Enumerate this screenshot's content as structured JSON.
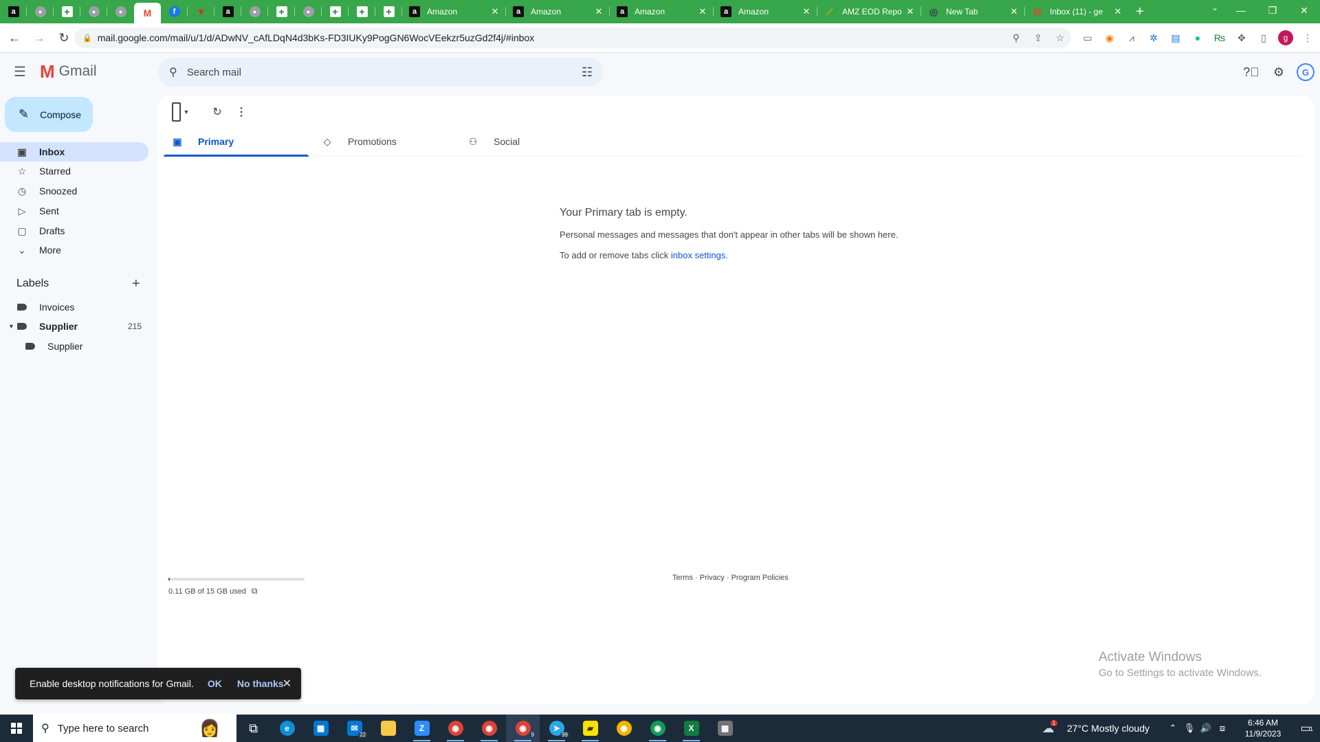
{
  "browser": {
    "pinned_tabs": [
      {
        "icon": "amazon-icon",
        "glyph": "a"
      },
      {
        "icon": "globe-icon",
        "glyph": "●"
      },
      {
        "icon": "sheets-icon",
        "glyph": "+"
      },
      {
        "icon": "globe-icon",
        "glyph": "●"
      },
      {
        "icon": "globe-icon",
        "glyph": "●"
      },
      {
        "icon": "gmail-icon",
        "glyph": "M"
      },
      {
        "icon": "facebook-icon",
        "glyph": "f"
      },
      {
        "icon": "red-shield-icon",
        "glyph": "▼"
      },
      {
        "icon": "amazon-icon",
        "glyph": "a"
      },
      {
        "icon": "globe-icon",
        "glyph": "●"
      },
      {
        "icon": "sheets-icon",
        "glyph": "+"
      },
      {
        "icon": "globe-icon",
        "glyph": "●"
      },
      {
        "icon": "sheets-icon",
        "glyph": "+"
      },
      {
        "icon": "sheets-icon",
        "glyph": "+"
      },
      {
        "icon": "sheets-icon",
        "glyph": "+"
      }
    ],
    "tabs": [
      {
        "title": "Amazon",
        "icon": "amazon-icon"
      },
      {
        "title": "Amazon",
        "icon": "amazon-icon"
      },
      {
        "title": "Amazon",
        "icon": "amazon-icon"
      },
      {
        "title": "Amazon",
        "icon": "amazon-icon"
      },
      {
        "title": "AMZ EOD Repo",
        "icon": "amz-eod-icon"
      },
      {
        "title": "New Tab",
        "icon": "chrome-icon"
      },
      {
        "title": "Inbox (11) - ge",
        "icon": "gmail-icon"
      }
    ],
    "url": "mail.google.com/mail/u/1/d/ADwNV_cAfLDqN4d3bKs-FD3IUKy9PogGN6WocVEekzr5uzGd2f4j/#inbox",
    "profile_initial": "g",
    "accent_color": "#38a64a"
  },
  "gmail": {
    "app_name": "Gmail",
    "search_placeholder": "Search mail",
    "compose_label": "Compose",
    "nav": [
      {
        "label": "Inbox",
        "icon": "inbox-icon",
        "active": true
      },
      {
        "label": "Starred",
        "icon": "star-icon"
      },
      {
        "label": "Snoozed",
        "icon": "clock-icon"
      },
      {
        "label": "Sent",
        "icon": "send-icon"
      },
      {
        "label": "Drafts",
        "icon": "draft-icon"
      },
      {
        "label": "More",
        "icon": "chevron-down-icon"
      }
    ],
    "labels_heading": "Labels",
    "labels": [
      {
        "label": "Invoices"
      },
      {
        "label": "Supplier",
        "count": "215"
      },
      {
        "label": "Supplier"
      }
    ],
    "tabs": [
      {
        "label": "Primary",
        "icon": "inbox-tab-icon"
      },
      {
        "label": "Promotions",
        "icon": "tag-icon"
      },
      {
        "label": "Social",
        "icon": "people-icon"
      }
    ],
    "empty": {
      "title": "Your Primary tab is empty.",
      "line1": "Personal messages and messages that don't appear in other tabs will be shown here.",
      "line2_prefix": "To add or remove tabs click ",
      "line2_link": "inbox settings",
      "line2_suffix": "."
    },
    "storage": {
      "text": "0.11 GB of 15 GB used",
      "fraction": 0.0073
    },
    "footer": {
      "terms": "Terms",
      "privacy": "Privacy",
      "policies": "Program Policies",
      "sep": " · "
    },
    "toast": {
      "message": "Enable desktop notifications for Gmail.",
      "ok": "OK",
      "no": "No thanks"
    }
  },
  "watermark": {
    "line1": "Activate Windows",
    "line2": "Go to Settings to activate Windows."
  },
  "taskbar": {
    "search_placeholder": "Type here to search",
    "mail_badge": "22",
    "chrome_badge": "9",
    "telegram_badge": "99",
    "weather_badge": "1",
    "weather": "27°C  Mostly cloudy",
    "time": "6:46 AM",
    "date": "11/9/2023",
    "notif_count": "1"
  }
}
